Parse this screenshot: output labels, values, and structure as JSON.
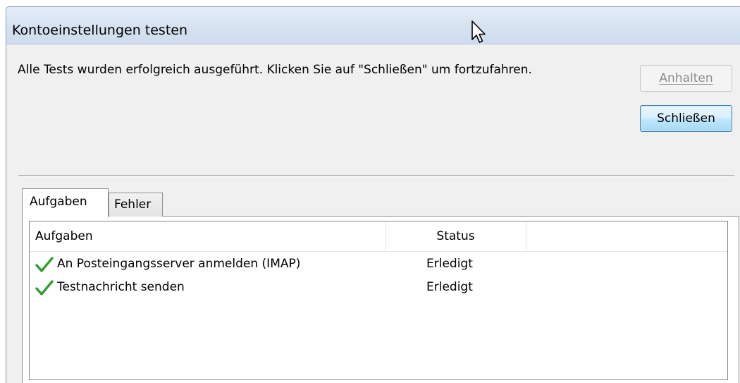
{
  "window": {
    "title": "Kontoeinstellungen testen"
  },
  "message": "Alle Tests wurden erfolgreich ausgeführt. Klicken Sie auf \"Schließen\" um fortzufahren.",
  "buttons": {
    "stop_label": "Anhalten",
    "close_label": "Schließen"
  },
  "tabs": [
    {
      "label": "Aufgaben",
      "selected": true
    },
    {
      "label": "Fehler",
      "selected": false
    }
  ],
  "table": {
    "columns": [
      "Aufgaben",
      "Status",
      ""
    ],
    "rows": [
      {
        "icon": "checkmark-icon",
        "task": "An Posteingangsserver anmelden (IMAP)",
        "status": "Erledigt"
      },
      {
        "icon": "checkmark-icon",
        "task": "Testnachricht senden",
        "status": "Erledigt"
      }
    ]
  },
  "colors": {
    "titlebar": "#d6e3f1",
    "dialog_bg": "#f0f0f0",
    "checkmark": "#2f9e2f",
    "button_focus_border": "#3c7fb1",
    "disabled_text": "#8d8d8d"
  },
  "icons": {
    "cursor": "mouse-pointer-icon",
    "row_status": "checkmark-icon"
  }
}
